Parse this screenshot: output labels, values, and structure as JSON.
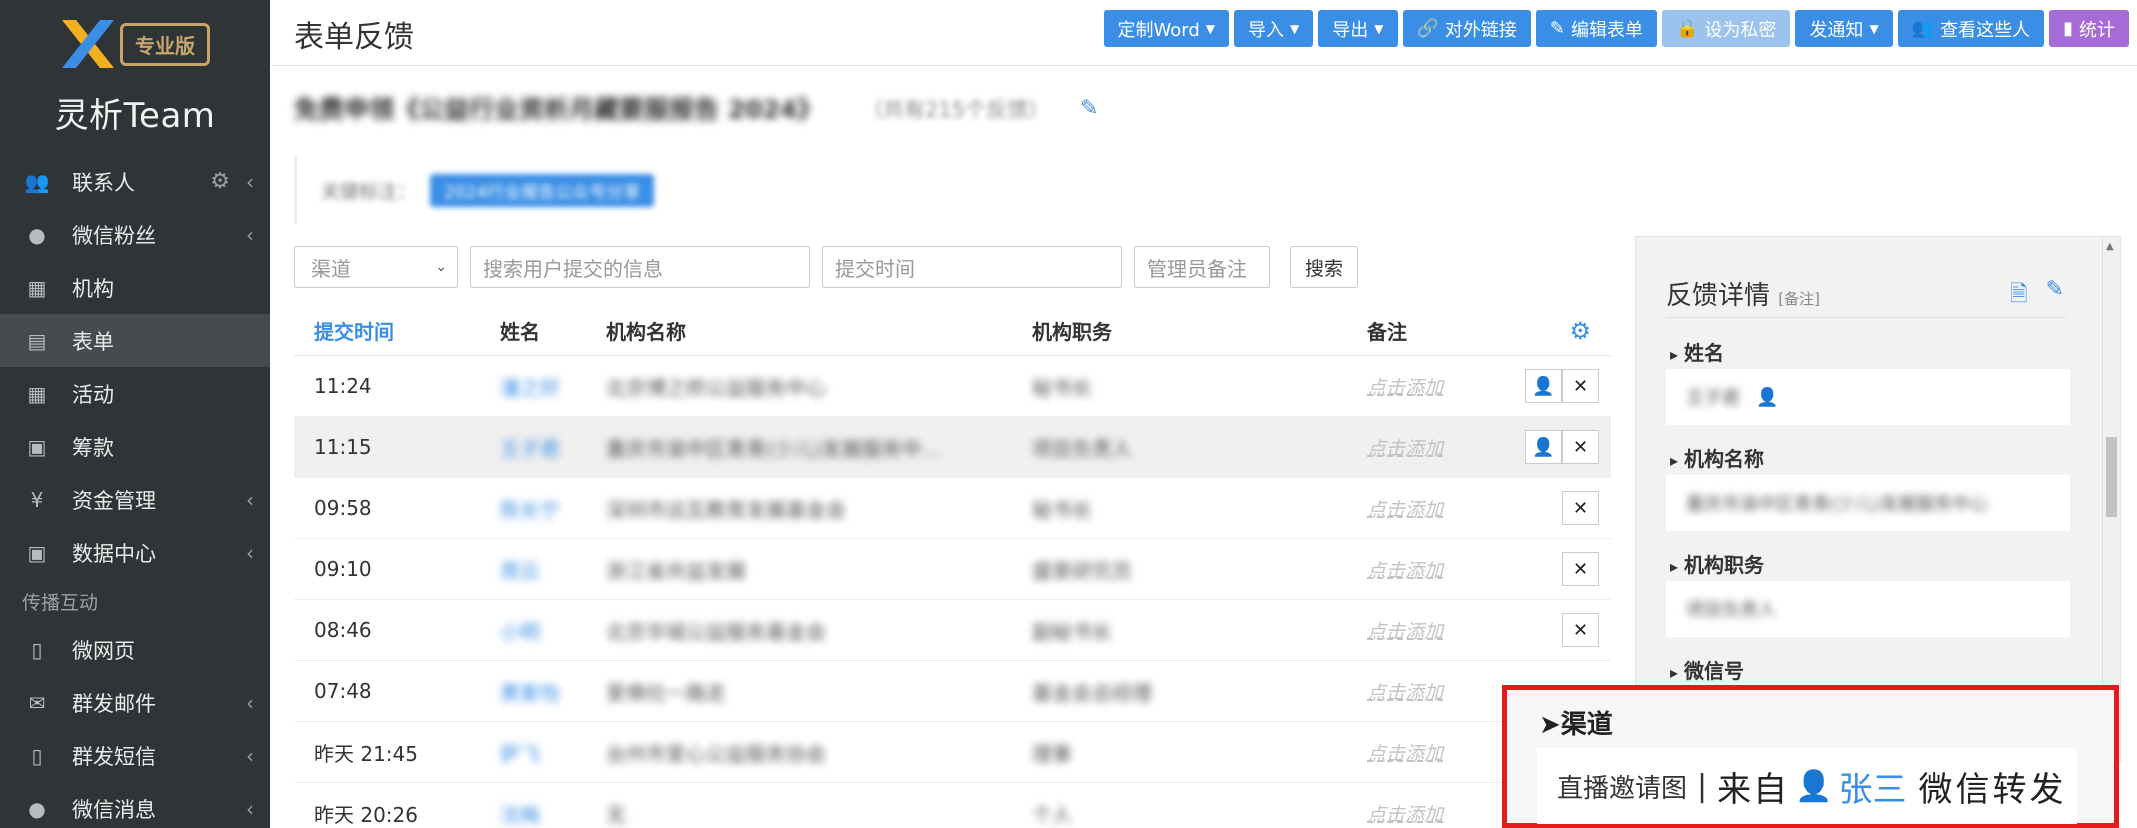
{
  "sidebar": {
    "badge": "专业版",
    "brand_cn": "灵析",
    "brand_en": "Team",
    "items": [
      {
        "label": "联系人",
        "icon": "users-icon"
      },
      {
        "label": "微信粉丝",
        "icon": "comment-icon"
      },
      {
        "label": "机构",
        "icon": "building-icon"
      },
      {
        "label": "表单",
        "icon": "clipboard-icon"
      },
      {
        "label": "活动",
        "icon": "calendar-icon"
      },
      {
        "label": "筹款",
        "icon": "donate-icon"
      },
      {
        "label": "资金管理",
        "icon": "yen-icon"
      },
      {
        "label": "数据中心",
        "icon": "database-icon"
      }
    ],
    "section_label": "传播互动",
    "items2": [
      {
        "label": "微网页",
        "icon": "page-icon"
      },
      {
        "label": "群发邮件",
        "icon": "envelope-icon"
      },
      {
        "label": "群发短信",
        "icon": "phone-icon"
      },
      {
        "label": "微信消息",
        "icon": "wechat-icon"
      }
    ]
  },
  "header": {
    "title": "表单反馈",
    "buttons": {
      "word": "定制Word",
      "import": "导入",
      "export": "导出",
      "link": "对外链接",
      "edit": "编辑表单",
      "private": "设为私密",
      "notify": "发通知",
      "view": "查看这些人",
      "stats": "统计"
    }
  },
  "form": {
    "title": "免费申领《公益行业资析月藏要服报告 2024》",
    "count": "（共有215个反馈）",
    "note_label": "关键标注：",
    "note_tag": "2024行业报告公众号分享"
  },
  "filters": {
    "channel": "渠道",
    "search_placeholder": "搜索用户提交的信息",
    "time_placeholder": "提交时间",
    "remark_placeholder": "管理员备注",
    "search_button": "搜索"
  },
  "table": {
    "headers": {
      "time": "提交时间",
      "name": "姓名",
      "org": "机构名称",
      "job": "机构职务",
      "note": "备注"
    },
    "add_note": "点击添加",
    "rows": [
      {
        "time": "11:24",
        "name": "潘之轩",
        "org": "北京博之桥公益服务中心",
        "job": "秘书长"
      },
      {
        "time": "11:15",
        "name": "王子君",
        "org": "重庆市渝中区青青(少儿)发展服务中…",
        "job": "项目负责人"
      },
      {
        "time": "09:58",
        "name": "陈长宁",
        "org": "深圳市远瓦教育发展基金会",
        "job": "秘书长"
      },
      {
        "time": "09:10",
        "name": "周云",
        "org": "浙江省共益发展",
        "job": "盛景研究员"
      },
      {
        "time": "08:46",
        "name": "小明",
        "org": "北京华城公益服务基金会",
        "job": "副秘书长"
      },
      {
        "time": "07:48",
        "name": "黄紫怡",
        "org": "爱佛社一路走",
        "job": "基金会总经理"
      },
      {
        "time": "昨天 21:45",
        "name": "萨飞",
        "org": "台州市爱心公益服务协会",
        "job": "理事"
      },
      {
        "time": "昨天 20:26",
        "name": "沈梅",
        "org": "无",
        "job": "个人"
      }
    ]
  },
  "panel": {
    "title": "反馈详情",
    "title_note": "[备注]",
    "fields": [
      {
        "label": "姓名",
        "value": "王子君"
      },
      {
        "label": "机构名称",
        "value": "重庆市渝中区青青(少儿)发展服务中心"
      },
      {
        "label": "机构职务",
        "value": "项目负责人"
      },
      {
        "label": "微信号",
        "value": ""
      }
    ]
  },
  "channel_detail": {
    "title": "渠道",
    "source": "直播邀请图",
    "separator": "|",
    "from": "来自",
    "user": "张三",
    "action": "微信转发"
  },
  "colors": {
    "primary": "#3a8ee6",
    "sidebar": "#2f3437",
    "highlight": "#e21b1b",
    "purple": "#a66bd6"
  }
}
